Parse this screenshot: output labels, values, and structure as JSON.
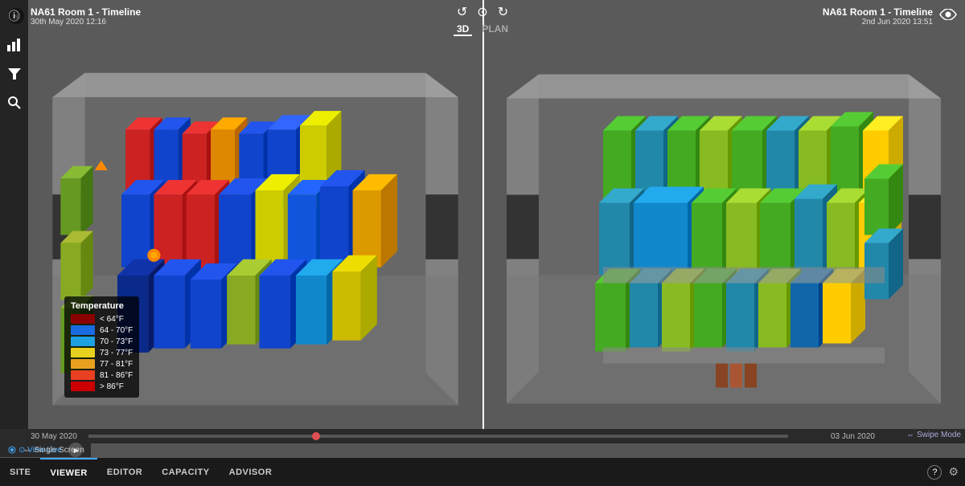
{
  "header": {
    "left_title": "NA61 Room 1 - Timeline",
    "left_date": "30th May 2020 12:16",
    "right_title": "NA61 Room 1 - Timeline",
    "right_date": "2nd Jun 2020 13:51"
  },
  "view_controls": {
    "rotate_left": "↺",
    "reset": "◎",
    "rotate_right": "↻",
    "tab_3d": "3D",
    "tab_plan": "PLAN"
  },
  "sidebar": {
    "icons": [
      "ⓘ",
      "📊",
      "▼",
      "🔍"
    ]
  },
  "legend": {
    "title": "Temperature",
    "items": [
      {
        "label": "< 64°F",
        "color": "#8B0000"
      },
      {
        "label": "64 - 70°F",
        "color": "#1a6be0"
      },
      {
        "label": "70 - 73°F",
        "color": "#1fa0e0"
      },
      {
        "label": "73 - 77°F",
        "color": "#e8d020"
      },
      {
        "label": "77 - 81°F",
        "color": "#e8a020"
      },
      {
        "label": "81 - 86°F",
        "color": "#e84020"
      },
      {
        "label": "> 86°F",
        "color": "#cc0000"
      }
    ]
  },
  "timeline": {
    "left_label": "30 May 2020",
    "right_label": "03 Jun 2020",
    "swipe_mode": "Swipe Mode"
  },
  "playback": {
    "view_live": "⊙ View Live",
    "play_icon": "▶"
  },
  "nav": {
    "items": [
      "SITE",
      "VIEWER",
      "EDITOR",
      "CAPACITY",
      "ADVISOR"
    ],
    "single_screen": "Single Screen"
  }
}
